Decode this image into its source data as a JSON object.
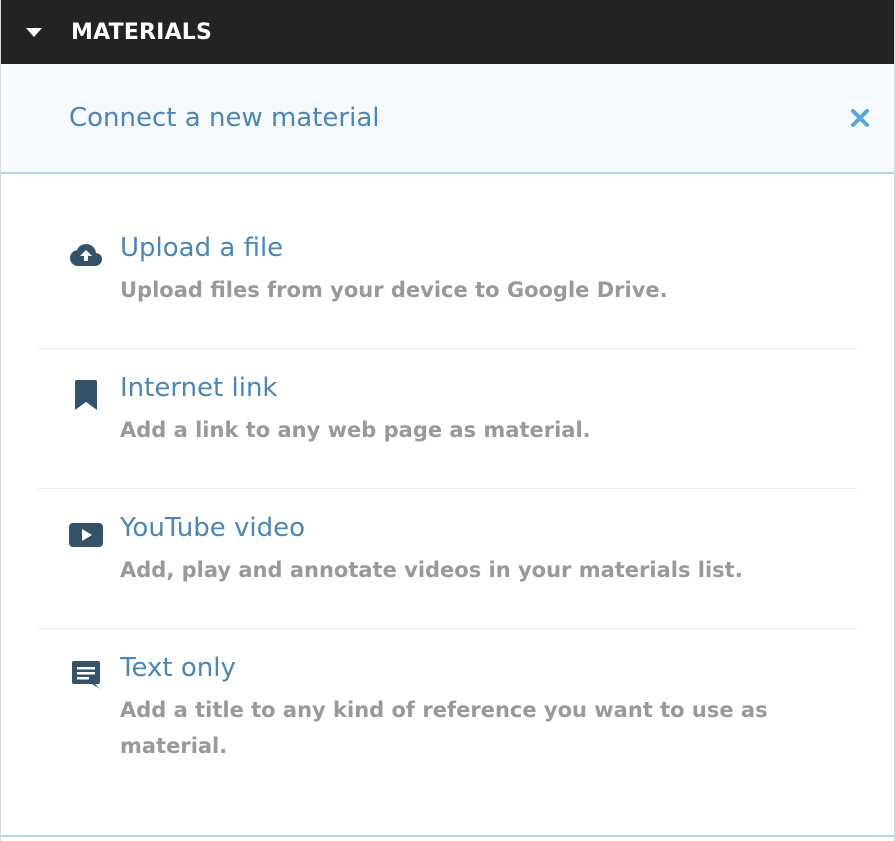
{
  "header": {
    "title": "MATERIALS",
    "caret_icon": "caret-down-icon"
  },
  "connect": {
    "title": "Connect a new material",
    "close_icon": "close-icon"
  },
  "options": [
    {
      "icon": "cloud-upload-icon",
      "label": "Upload a file",
      "description": "Upload files from your device to Google Drive."
    },
    {
      "icon": "bookmark-icon",
      "label": "Internet link",
      "description": "Add a link to any web page as material."
    },
    {
      "icon": "youtube-play-icon",
      "label": "YouTube video",
      "description": "Add, play and annotate videos in your materials list."
    },
    {
      "icon": "comment-text-icon",
      "label": "Text only",
      "description": "Add a title to any kind of reference you want to use as material."
    }
  ],
  "colors": {
    "header_bg": "#232323",
    "accent": "#4b86b4",
    "icon": "#34536a",
    "close": "#5aa5dc",
    "muted_text": "#999999",
    "connect_bg": "#f6f9fd",
    "rule": "#b9d3ea"
  }
}
